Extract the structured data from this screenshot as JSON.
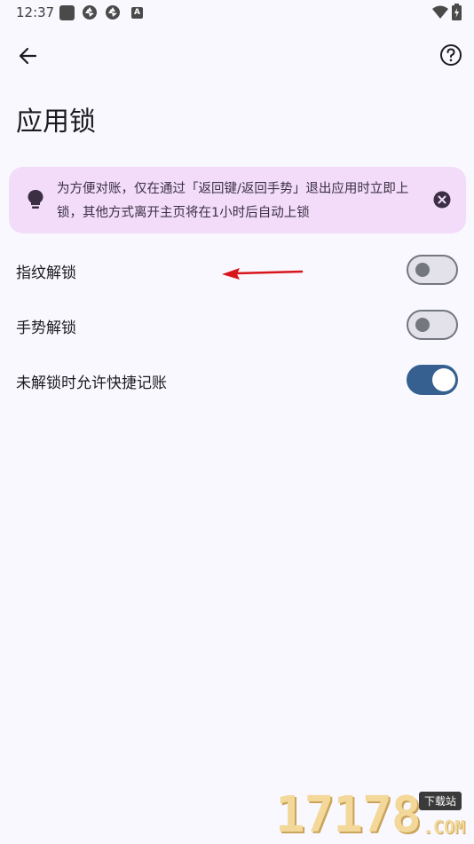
{
  "status_bar": {
    "time": "12:37",
    "notification_badge": "A"
  },
  "header": {
    "title": "应用锁"
  },
  "tip": {
    "text": "为方便对账，仅在通过「返回键/返回手势」退出应用时立即上锁，其他方式离开主页将在1小时后自动上锁"
  },
  "settings": [
    {
      "label": "指纹解锁",
      "enabled": false
    },
    {
      "label": "手势解锁",
      "enabled": false
    },
    {
      "label": "未解锁时允许快捷记账",
      "enabled": true
    }
  ],
  "colors": {
    "background": "#f8f8fe",
    "tip_background": "#f2dcf9",
    "switch_on": "#35608f",
    "switch_off_border": "#74777f",
    "annotation_arrow": "#d9141a"
  },
  "watermark": {
    "digits": "17178",
    "badge": "下载站",
    "suffix": ".COM"
  }
}
